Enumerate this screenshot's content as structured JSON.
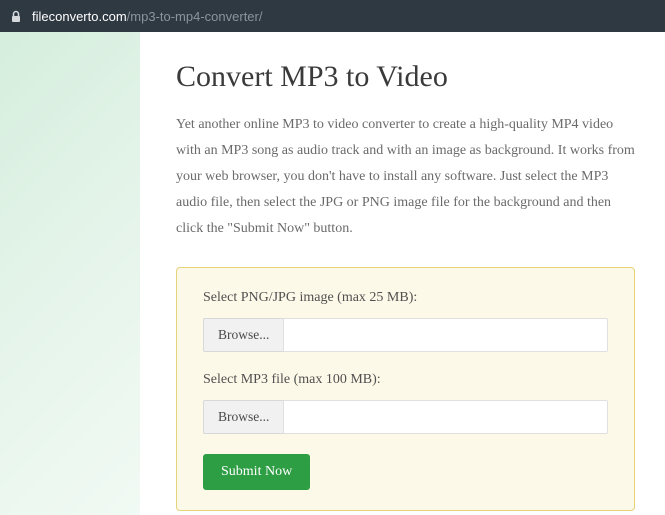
{
  "url": {
    "host": "fileconverto.com",
    "path": "/mp3-to-mp4-converter/"
  },
  "page": {
    "title": "Convert MP3 to Video",
    "description": "Yet another online MP3 to video converter to create a high-quality MP4 video with an MP3 song as audio track and with an image as background. It works from your web browser, you don't have to install any software. Just select the MP3 audio file, then select the JPG or PNG image file for the background and then click the \"Submit Now\" button."
  },
  "form": {
    "image_label": "Select PNG/JPG image (max 25 MB):",
    "image_browse": "Browse...",
    "image_value": "",
    "mp3_label": "Select MP3 file (max 100 MB):",
    "mp3_browse": "Browse...",
    "mp3_value": "",
    "submit_label": "Submit Now"
  }
}
